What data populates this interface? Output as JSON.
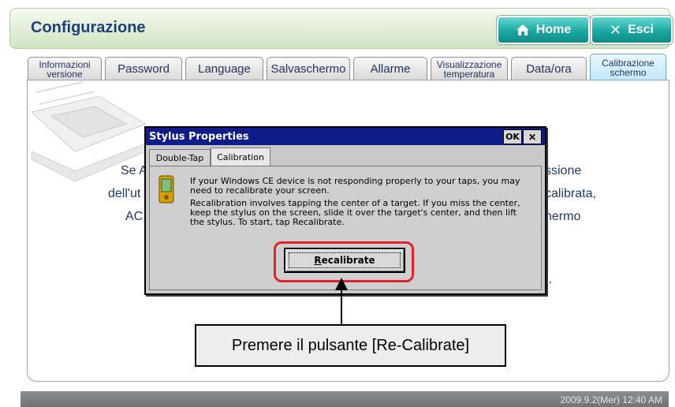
{
  "header": {
    "title": "Configurazione",
    "home_label": "Home",
    "exit_label": "Esci"
  },
  "tabs": [
    {
      "label": "Informazioni versione",
      "size": "small"
    },
    {
      "label": "Password",
      "size": "normal"
    },
    {
      "label": "Language",
      "size": "normal"
    },
    {
      "label": "Salvaschermo",
      "size": "normal"
    },
    {
      "label": "Allarme",
      "size": "normal"
    },
    {
      "label": "Visualizzazione temperatura",
      "size": "small"
    },
    {
      "label": "Data/ora",
      "size": "normal"
    },
    {
      "label": "Calibrazione schermo",
      "size": "small",
      "active": true
    }
  ],
  "background_text": {
    "left_line1": "Se A",
    "left_line2": "dell'ut",
    "left_line3": "AC",
    "right_line1": "ssione",
    "right_line2": "calibrata,",
    "right_line3": "hermo",
    "right_line4": "]."
  },
  "dialog": {
    "title": "Stylus Properties",
    "ok_label": "OK",
    "close_label": "✕",
    "tabs": [
      {
        "label": "Double-Tap"
      },
      {
        "label": "Calibration",
        "selected": true
      }
    ],
    "text1": "If your Windows CE device is not responding properly to your taps, you may need to recalibrate your screen.",
    "text2": "Recalibration involves tapping the center of a target. If you miss the center, keep the stylus on the screen, slide it over the target's center, and then lift the stylus. To start, tap Recalibrate.",
    "button_label": "Recalibrate",
    "button_mnemonic": "R"
  },
  "callout": {
    "text": "Premere il pulsante [Re-Calibrate]"
  },
  "statusbar": {
    "datetime": "2009.9.2(Mer)  12:40 AM"
  },
  "colors": {
    "accent": "#1aa7a2",
    "title_blue": "#1f3f79",
    "dialog_title_bg": "#0f1d8a",
    "highlight": "#e2232a"
  },
  "icons": {
    "home": "home-icon",
    "exit": "close-icon",
    "device": "pda-icon"
  }
}
